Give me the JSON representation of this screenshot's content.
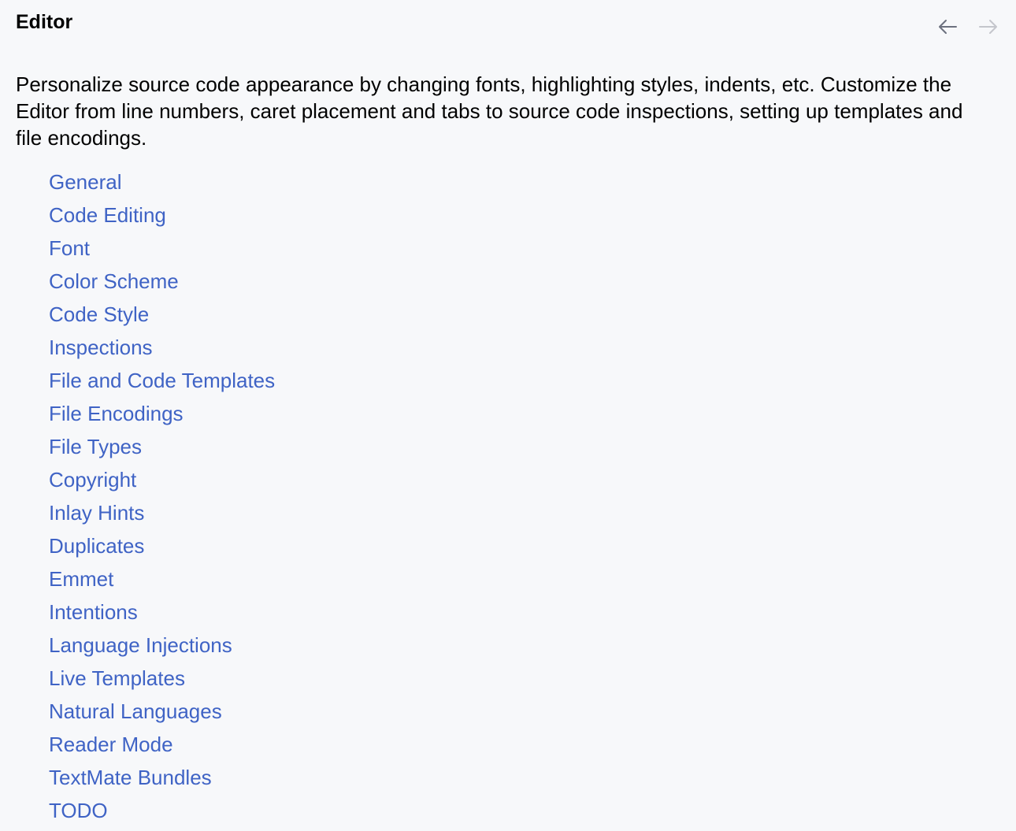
{
  "header": {
    "title": "Editor",
    "back_icon": "arrow-left-icon",
    "forward_icon": "arrow-right-icon",
    "back_color": "#6c707e",
    "forward_color": "#c4c6cc"
  },
  "description": "Personalize source code appearance by changing fonts, highlighting styles, indents, etc. Customize the Editor from line numbers, caret placement and tabs to source code inspections, setting up templates and file encodings.",
  "colors": {
    "link": "#3f63c5",
    "background": "#f7f8fa"
  },
  "links": [
    "General",
    "Code Editing",
    "Font",
    "Color Scheme",
    "Code Style",
    "Inspections",
    "File and Code Templates",
    "File Encodings",
    "File Types",
    "Copyright",
    "Inlay Hints",
    "Duplicates",
    "Emmet",
    "Intentions",
    "Language Injections",
    "Live Templates",
    "Natural Languages",
    "Reader Mode",
    "TextMate Bundles",
    "TODO"
  ]
}
